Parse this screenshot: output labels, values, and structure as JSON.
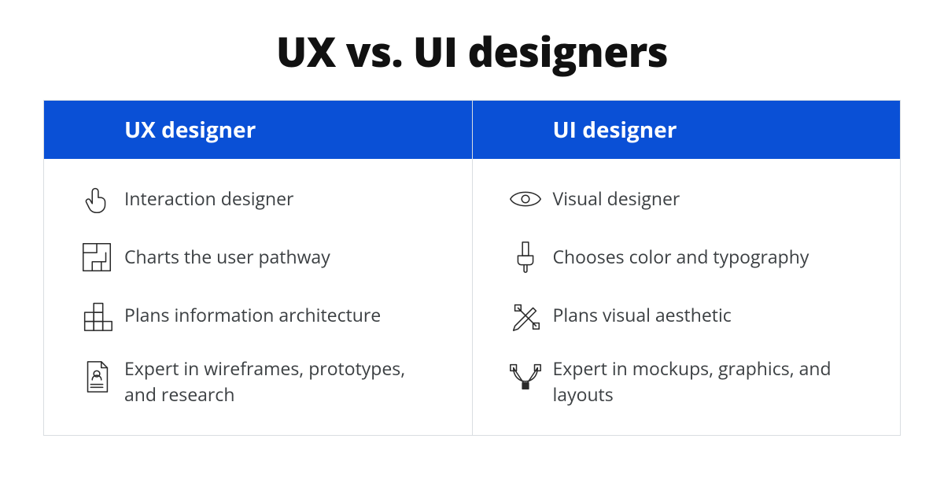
{
  "title": "UX vs. UI designers",
  "columns": {
    "ux": {
      "header": "UX designer",
      "items": [
        {
          "icon": "pointer-icon",
          "label": "Interaction designer"
        },
        {
          "icon": "maze-icon",
          "label": "Charts the user pathway"
        },
        {
          "icon": "blocks-icon",
          "label": "Plans information architecture"
        },
        {
          "icon": "document-icon",
          "label": "Expert in wireframes, prototypes, and research"
        }
      ]
    },
    "ui": {
      "header": "UI designer",
      "items": [
        {
          "icon": "eye-icon",
          "label": "Visual designer"
        },
        {
          "icon": "brush-icon",
          "label": "Chooses color and typography"
        },
        {
          "icon": "tools-icon",
          "label": "Plans visual aesthetic"
        },
        {
          "icon": "vector-icon",
          "label": "Expert in mockups, graphics, and layouts"
        }
      ]
    }
  },
  "colors": {
    "header_bg": "#0a50d6",
    "border": "#d9dde1",
    "text": "#3c4043"
  }
}
